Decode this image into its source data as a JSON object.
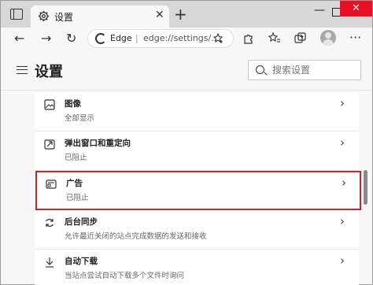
{
  "browser": {
    "tab_title": "设置",
    "close_tab": "✕",
    "new_tab": "+",
    "window_minimize": "—",
    "window_close": "✕"
  },
  "toolbar": {
    "back": "←",
    "forward": "→",
    "refresh": "↻",
    "address_brand": "Edge",
    "address_separator": "|",
    "address_url": "edge://settings/..."
  },
  "header": {
    "title": "设置",
    "search_placeholder": "搜索设置"
  },
  "settings_items": [
    {
      "title": "图像",
      "description": "全部显示",
      "icon": "image-icon"
    },
    {
      "title": "弹出窗口和重定向",
      "description": "已阻止",
      "icon": "popup-icon"
    },
    {
      "title": "广告",
      "description": "已阻止",
      "icon": "ads-icon",
      "highlighted": true
    },
    {
      "title": "后台同步",
      "description": "允许最近关闭的站点完成数据的发送和接收",
      "icon": "sync-icon"
    },
    {
      "title": "自动下载",
      "description": "当站点尝试自动下载多个文件时询问",
      "icon": "download-icon"
    }
  ],
  "colors": {
    "highlight_border": "#c8262c",
    "close_button": "#e81123"
  }
}
